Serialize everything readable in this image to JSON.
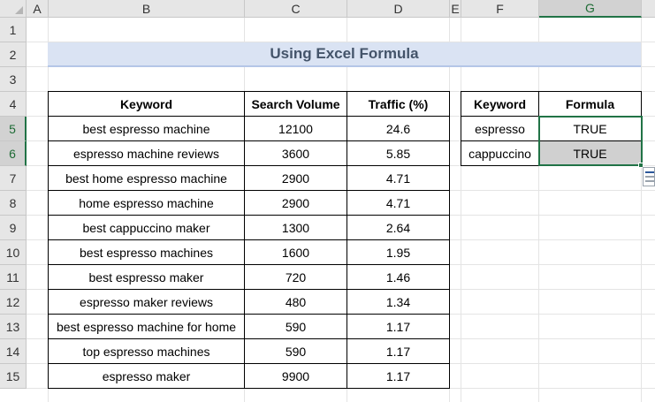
{
  "columns": [
    "A",
    "B",
    "C",
    "D",
    "E",
    "F",
    "G"
  ],
  "selected_column": "G",
  "rows": [
    "1",
    "2",
    "3",
    "4",
    "5",
    "6",
    "7",
    "8",
    "9",
    "10",
    "11",
    "12",
    "13",
    "14",
    "15"
  ],
  "selected_rows": [
    "5",
    "6"
  ],
  "title": "Using Excel Formula",
  "main_table": {
    "headers": [
      "Keyword",
      "Search Volume",
      "Traffic (%)"
    ],
    "rows": [
      [
        "best espresso machine",
        "12100",
        "24.6"
      ],
      [
        "espresso machine reviews",
        "3600",
        "5.85"
      ],
      [
        "best home espresso machine",
        "2900",
        "4.71"
      ],
      [
        "home espresso machine",
        "2900",
        "4.71"
      ],
      [
        "best cappuccino maker",
        "1300",
        "2.64"
      ],
      [
        "best espresso machines",
        "1600",
        "1.95"
      ],
      [
        "best espresso maker",
        "720",
        "1.46"
      ],
      [
        "espresso maker reviews",
        "480",
        "1.34"
      ],
      [
        "best espresso machine for home",
        "590",
        "1.17"
      ],
      [
        "top espresso machines",
        "590",
        "1.17"
      ],
      [
        "espresso maker",
        "9900",
        "1.17"
      ]
    ]
  },
  "lookup_table": {
    "headers": [
      "Keyword",
      "Formula"
    ],
    "rows": [
      [
        "espresso",
        "TRUE"
      ],
      [
        "cappuccino",
        "TRUE"
      ]
    ]
  },
  "icons": {
    "quick_analysis": "quick-analysis-icon",
    "select_all": "select-all-triangle-icon"
  },
  "colors": {
    "selection": "#217346",
    "title_fill": "#dae3f3",
    "title_text": "#44546a",
    "header_bg": "#e6e6e6"
  }
}
